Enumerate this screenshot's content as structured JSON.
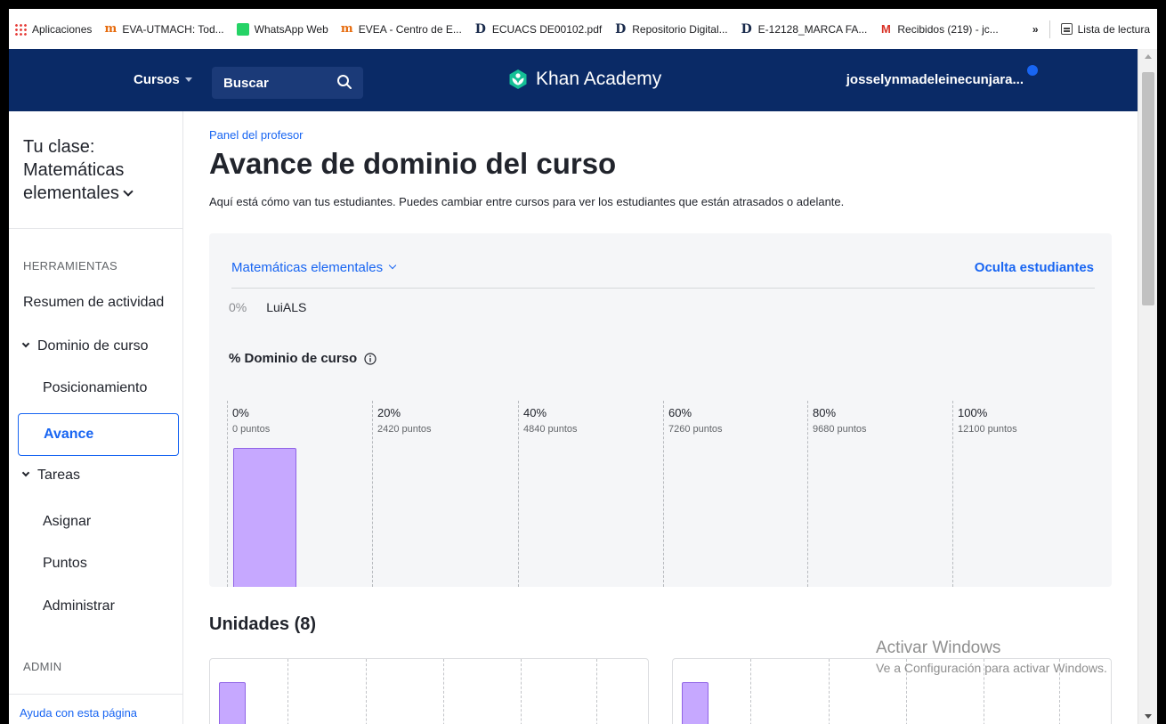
{
  "bookmarks": {
    "items": [
      {
        "label": "Aplicaciones",
        "icon": "apps-grid-icon"
      },
      {
        "label": "EVA-UTMACH: Tod...",
        "icon": "moodle-icon"
      },
      {
        "label": "WhatsApp Web",
        "icon": "whatsapp-icon"
      },
      {
        "label": "EVEA - Centro de E...",
        "icon": "moodle-icon"
      },
      {
        "label": "ECUACS DE00102.pdf",
        "icon": "document-d-icon"
      },
      {
        "label": "Repositorio Digital...",
        "icon": "document-d-icon"
      },
      {
        "label": "E-12128_MARCA FA...",
        "icon": "document-d-icon"
      },
      {
        "label": "Recibidos (219) - jc...",
        "icon": "gmail-icon"
      }
    ],
    "more": "»",
    "reading_list": "Lista de lectura"
  },
  "nav": {
    "courses": "Cursos",
    "search_label": "Buscar",
    "logo": "Khan Academy",
    "user": "josselynmadeleinecunjara..."
  },
  "sidebar": {
    "class_title_line1": "Tu clase:",
    "class_title_line2": "Matemáticas",
    "class_title_line3": "elementales",
    "tools_header": "HERRAMIENTAS",
    "activity_summary": "Resumen de actividad",
    "course_mastery": "Dominio de curso",
    "positioning": "Posicionamiento",
    "progress": "Avance",
    "assignments": "Tareas",
    "assign": "Asignar",
    "points": "Puntos",
    "manage": "Administrar",
    "admin_header": "ADMIN",
    "help": "Ayuda con esta página"
  },
  "main": {
    "breadcrumb": "Panel del profesor",
    "title": "Avance de dominio del curso",
    "description": "Aquí está cómo van tus estudiantes. Puedes cambiar entre cursos para ver los estudiantes que están atrasados o adelante.",
    "course_selector": "Matemáticas elementales",
    "hide_students": "Oculta estudiantes",
    "student": {
      "percent": "0%",
      "name": "LuiALS"
    },
    "mastery_label": "% Dominio de curso",
    "units_title": "Unidades (8)"
  },
  "chart_data": {
    "type": "bar",
    "title": "% Dominio de curso",
    "ticks": [
      {
        "pct": "0%",
        "points": "0 puntos"
      },
      {
        "pct": "20%",
        "points": "2420 puntos"
      },
      {
        "pct": "40%",
        "points": "4840 puntos"
      },
      {
        "pct": "60%",
        "points": "7260 puntos"
      },
      {
        "pct": "80%",
        "points": "9680 puntos"
      },
      {
        "pct": "100%",
        "points": "12100 puntos"
      }
    ],
    "categories": [
      "0%"
    ],
    "values": [
      1
    ],
    "bar_color": "#c6a8ff"
  },
  "watermark": {
    "title": "Activar Windows",
    "subtitle": "Ve a Configuración para activar Windows."
  },
  "colors": {
    "nav_bg": "#0a2a66",
    "accent": "#1865f2",
    "bar": "#c6a8ff"
  }
}
